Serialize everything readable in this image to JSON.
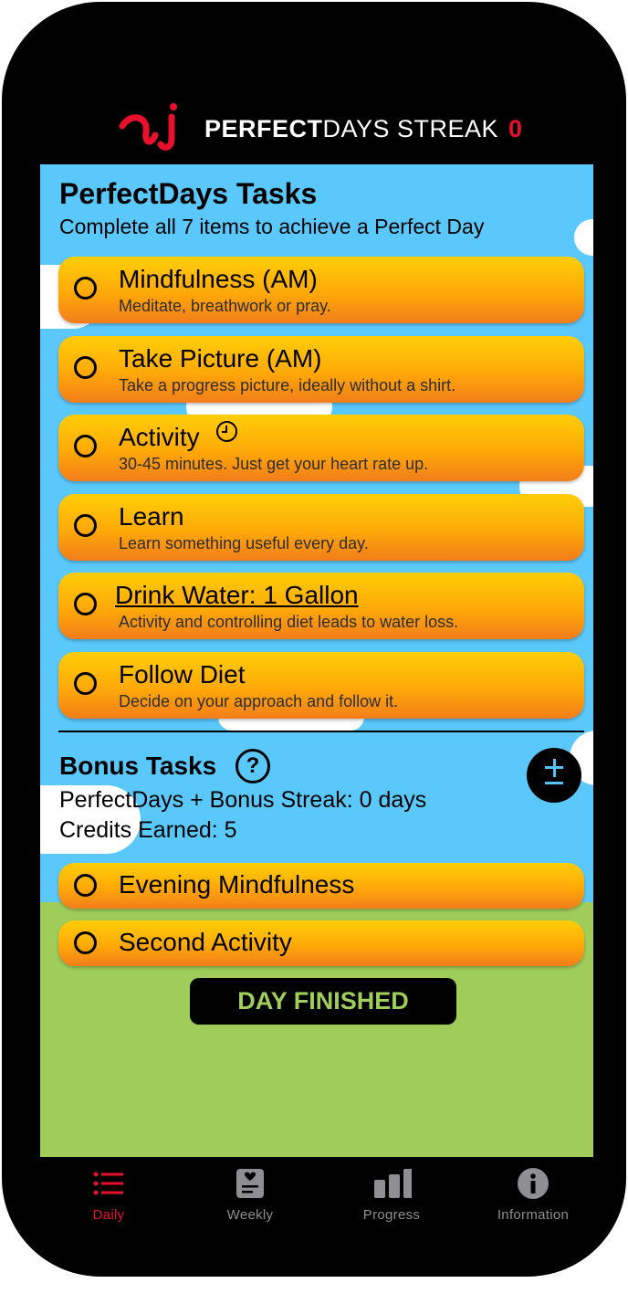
{
  "header": {
    "title_bold": "PERFECT",
    "title_rest": "DAYS STREAK",
    "streak_count": "0"
  },
  "tasks_section": {
    "title": "PerfectDays Tasks",
    "subtitle": "Complete all 7 items to achieve a Perfect Day"
  },
  "tasks": [
    {
      "title": "Mindfulness (AM)",
      "description": "Meditate, breathwork or pray."
    },
    {
      "title": "Take Picture (AM)",
      "description": "Take a progress picture, ideally without a shirt."
    },
    {
      "title": "Activity",
      "description": "30-45 minutes. Just get your heart rate up.",
      "icon": "clock-icon"
    },
    {
      "title": "Learn",
      "description": "Learn something useful every day."
    },
    {
      "title": "Drink Water: 1 Gallon",
      "description": "Activity and controlling diet leads to water loss."
    },
    {
      "title": "Follow Diet",
      "description": "Decide on your approach and follow it."
    }
  ],
  "bonus": {
    "title": "Bonus Tasks",
    "help_label": "?",
    "streak_text": "PerfectDays + Bonus Streak: 0 days",
    "credits_text": "Credits Earned: 5",
    "tasks": [
      {
        "title": "Evening Mindfulness"
      },
      {
        "title": "Second Activity"
      }
    ]
  },
  "day_finished_label": "DAY FINISHED",
  "tabbar": [
    {
      "label": "Daily",
      "icon": "list-icon",
      "active": true
    },
    {
      "label": "Weekly",
      "icon": "journal-icon",
      "active": false
    },
    {
      "label": "Progress",
      "icon": "bar-chart-icon",
      "active": false
    },
    {
      "label": "Information",
      "icon": "info-icon",
      "active": false
    }
  ],
  "colors": {
    "accent_red": "#e8102c",
    "sky": "#5bc8fb",
    "grass": "#a0cc5a",
    "task_top": "#ffce07",
    "task_bottom": "#f27d1a"
  }
}
